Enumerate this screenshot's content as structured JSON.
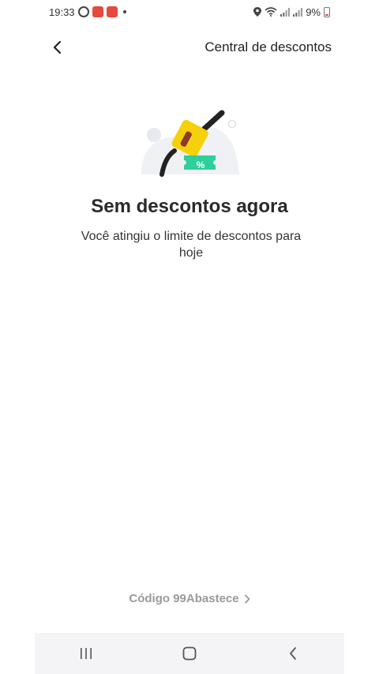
{
  "status_bar": {
    "time": "19:33",
    "battery": "9%",
    "icons": [
      "whatsapp-icon",
      "app-badge-icon",
      "app-badge-icon",
      "location-icon",
      "wifi-icon",
      "signal-icon",
      "signal-icon",
      "battery-icon"
    ]
  },
  "header": {
    "back_icon": "chevron-left-icon",
    "title": "Central de descontos"
  },
  "empty_state": {
    "illustration": "fuel-nozzle-discount-icon",
    "badge_text": "%",
    "title": "Sem descontos agora",
    "description": "Você atingiu o limite de descontos para hoje"
  },
  "footer": {
    "code_link": "Código 99Abastece",
    "chevron": "›"
  },
  "nav_bar": {
    "items": [
      "recent-apps-icon",
      "home-icon",
      "back-icon"
    ]
  },
  "colors": {
    "accent_yellow": "#f5d10a",
    "accent_green": "#2ecf9a",
    "link_gray": "#9a9a9a"
  }
}
